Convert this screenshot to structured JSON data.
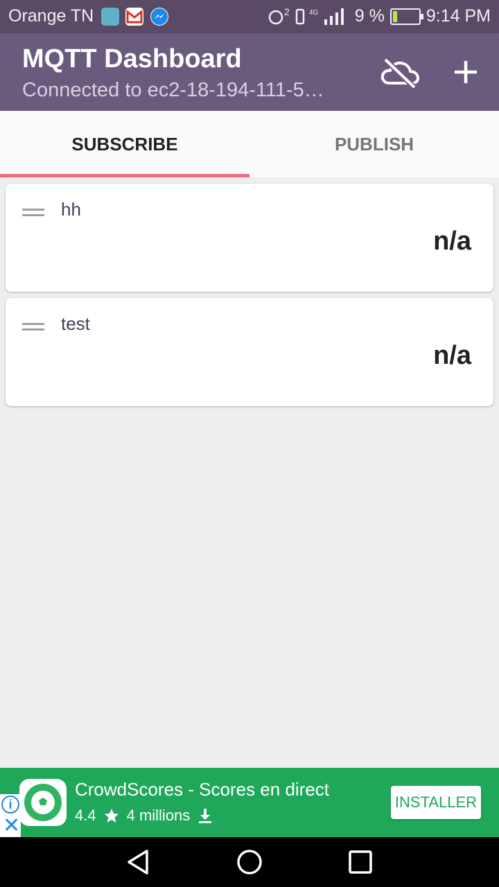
{
  "status_bar": {
    "carrier": "Orange TN",
    "network_superscript": "2",
    "battery_text": "9 %",
    "time": "9:14 PM",
    "icons": [
      "android-notification-icon",
      "gmail-icon",
      "messenger-icon",
      "data-saver-icon",
      "vibrate-icon",
      "4g-signal-icon",
      "battery-charging-icon"
    ]
  },
  "app_bar": {
    "title": "MQTT Dashboard",
    "subtitle": "Connected to ec2-18-194-111-5…",
    "actions": [
      "cloud-off-icon",
      "add-icon"
    ]
  },
  "tabs": [
    {
      "label": "SUBSCRIBE",
      "selected": true
    },
    {
      "label": "PUBLISH",
      "selected": false
    }
  ],
  "subscriptions": [
    {
      "name": "hh",
      "value": "n/a"
    },
    {
      "name": "test",
      "value": "n/a"
    }
  ],
  "ad": {
    "title": "CrowdScores - Scores en direct",
    "rating": "4.4",
    "installs": "4 millions",
    "install_label": "INSTALLER"
  },
  "colors": {
    "status_bar": "#5a4a66",
    "app_bar": "#6a5a7e",
    "tab_indicator": "#f06a80",
    "ad_background": "#1fa85a"
  }
}
